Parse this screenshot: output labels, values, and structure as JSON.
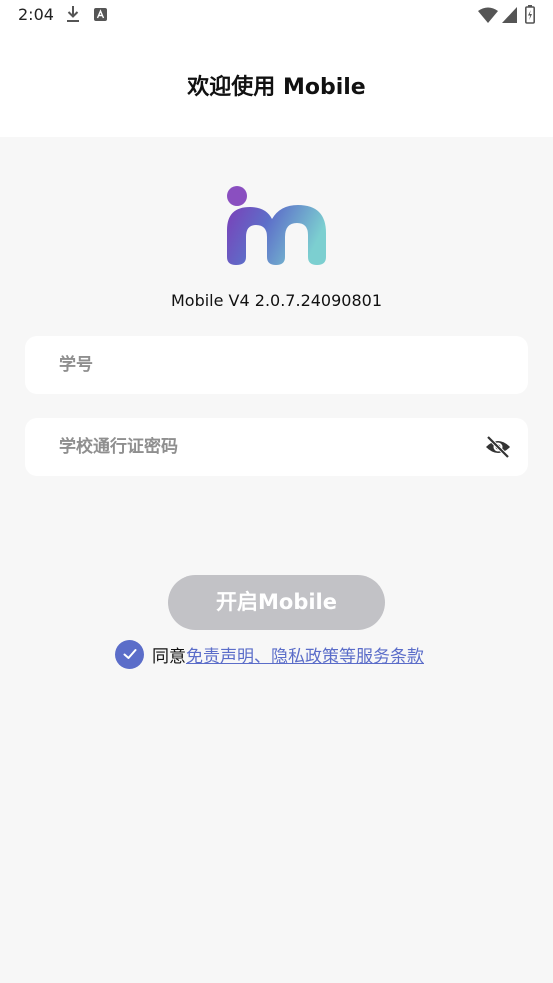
{
  "status_bar": {
    "time": "2:04",
    "icons": [
      "download-icon",
      "keyboard-icon",
      "wifi-icon",
      "signal-icon",
      "battery-icon"
    ]
  },
  "header": {
    "title": "欢迎使用 Mobile"
  },
  "app": {
    "version": "Mobile V4 2.0.7.24090801"
  },
  "form": {
    "student_id_placeholder": "学号",
    "password_placeholder": "学校通行证密码",
    "submit_label": "开启Mobile"
  },
  "agreement": {
    "prefix": "同意",
    "link_text": "免责声明、隐私政策等服务条款",
    "checked": true
  },
  "colors": {
    "accent": "#5b6dc9",
    "button_disabled": "#c2c2c6",
    "background": "#f7f7f7"
  }
}
